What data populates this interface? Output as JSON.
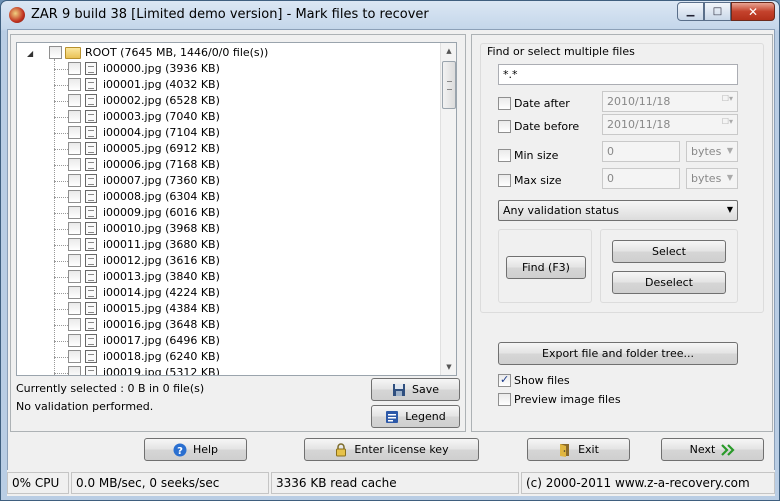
{
  "window": {
    "title": "ZAR 9 build 38 [Limited demo version] - Mark files to recover",
    "minimize_glyph": "▁",
    "maximize_glyph": "□",
    "close_glyph": "✕"
  },
  "tree": {
    "root_label": "ROOT (7645 MB, 1446/0/0 file(s))",
    "files": [
      "i00000.jpg (3936 KB)",
      "i00001.jpg (4032 KB)",
      "i00002.jpg (6528 KB)",
      "i00003.jpg (7040 KB)",
      "i00004.jpg (7104 KB)",
      "i00005.jpg (6912 KB)",
      "i00006.jpg (7168 KB)",
      "i00007.jpg (7360 KB)",
      "i00008.jpg (6304 KB)",
      "i00009.jpg (6016 KB)",
      "i00010.jpg (3968 KB)",
      "i00011.jpg (3680 KB)",
      "i00012.jpg (3616 KB)",
      "i00013.jpg (3840 KB)",
      "i00014.jpg (4224 KB)",
      "i00015.jpg (4384 KB)",
      "i00016.jpg (3648 KB)",
      "i00017.jpg (6496 KB)",
      "i00018.jpg (6240 KB)",
      "i00019.jpg (5312 KB)"
    ]
  },
  "selection": {
    "currently_selected": "Currently selected : 0 B in 0 file(s)",
    "validation": "No validation performed."
  },
  "tree_buttons": {
    "save": "Save",
    "legend": "Legend"
  },
  "find": {
    "group_title": "Find or select multiple files",
    "pattern": "*.*",
    "date_after_label": "Date after",
    "date_after_value": "2010/11/18",
    "date_before_label": "Date before",
    "date_before_value": "2010/11/18",
    "min_size_label": "Min size",
    "min_size_value": "0",
    "min_size_unit": "bytes",
    "max_size_label": "Max size",
    "max_size_value": "0",
    "max_size_unit": "bytes",
    "validation_status": "Any validation status",
    "find_button": "Find (F3)",
    "select_button": "Select",
    "deselect_button": "Deselect"
  },
  "export": {
    "button": "Export file and folder tree...",
    "show_files_label": "Show files",
    "show_files_checked": true,
    "preview_images_label": "Preview image files",
    "preview_images_checked": false
  },
  "bottom_buttons": {
    "help": "Help",
    "license": "Enter license key",
    "exit": "Exit",
    "next": "Next"
  },
  "statusbar": {
    "cpu": "0% CPU",
    "io": "0.0 MB/sec, 0 seeks/sec",
    "cache": "3336 KB read cache",
    "copyright": "(c) 2000-2011 www.z-a-recovery.com"
  },
  "colors": {
    "title_gradient_top": "#dbe7f4",
    "close_button": "#c4422c",
    "client_bg": "#f0f0f0"
  }
}
